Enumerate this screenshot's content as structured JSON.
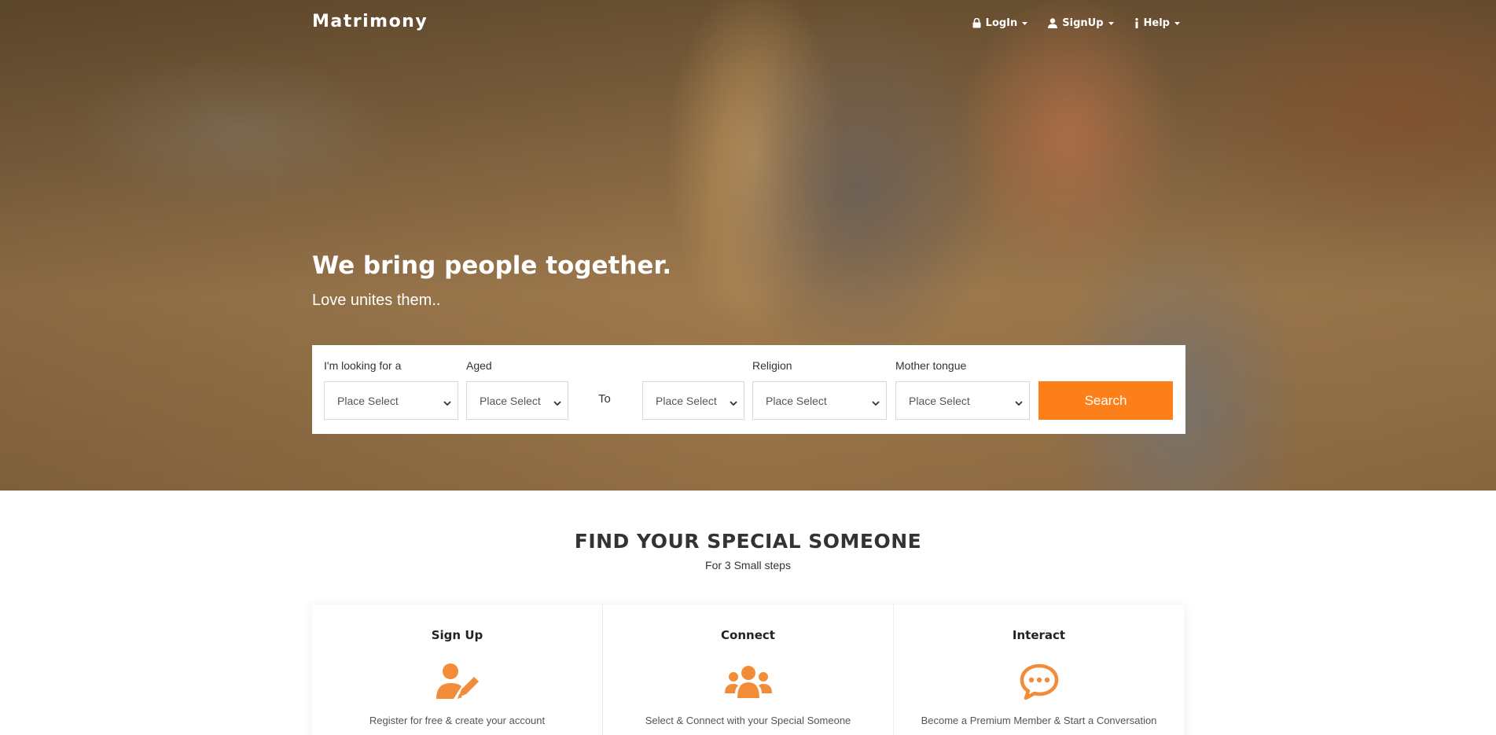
{
  "brand": "Matrimony",
  "nav": {
    "login": "LogIn",
    "signup": "SignUp",
    "help": "Help"
  },
  "hero": {
    "headline": "We bring people together.",
    "subhead": "Love unites them.."
  },
  "search": {
    "looking_for_label": "I'm looking for a",
    "aged_label": "Aged",
    "to_label": "To",
    "religion_label": "Religion",
    "mother_tongue_label": "Mother tongue",
    "looking_for_value": "Place Select",
    "age_from_value": "Place Select",
    "age_to_value": "Place Select",
    "religion_value": "Place Select",
    "mother_tongue_value": "Place Select",
    "button": "Search"
  },
  "section": {
    "title": "FIND YOUR SPECIAL SOMEONE",
    "subtitle": "For 3 Small steps"
  },
  "steps": [
    {
      "title": "Sign Up",
      "icon": "user-edit-icon",
      "text": "Register for free & create your account"
    },
    {
      "title": "Connect",
      "icon": "users-icon",
      "text": "Select & Connect with your Special Someone"
    },
    {
      "title": "Interact",
      "icon": "chat-bubble-icon",
      "text": "Become a Premium Member & Start a Conversation"
    }
  ],
  "colors": {
    "accent": "#fd7f1a",
    "icon": "#f28c38",
    "text_dark": "#333333"
  }
}
